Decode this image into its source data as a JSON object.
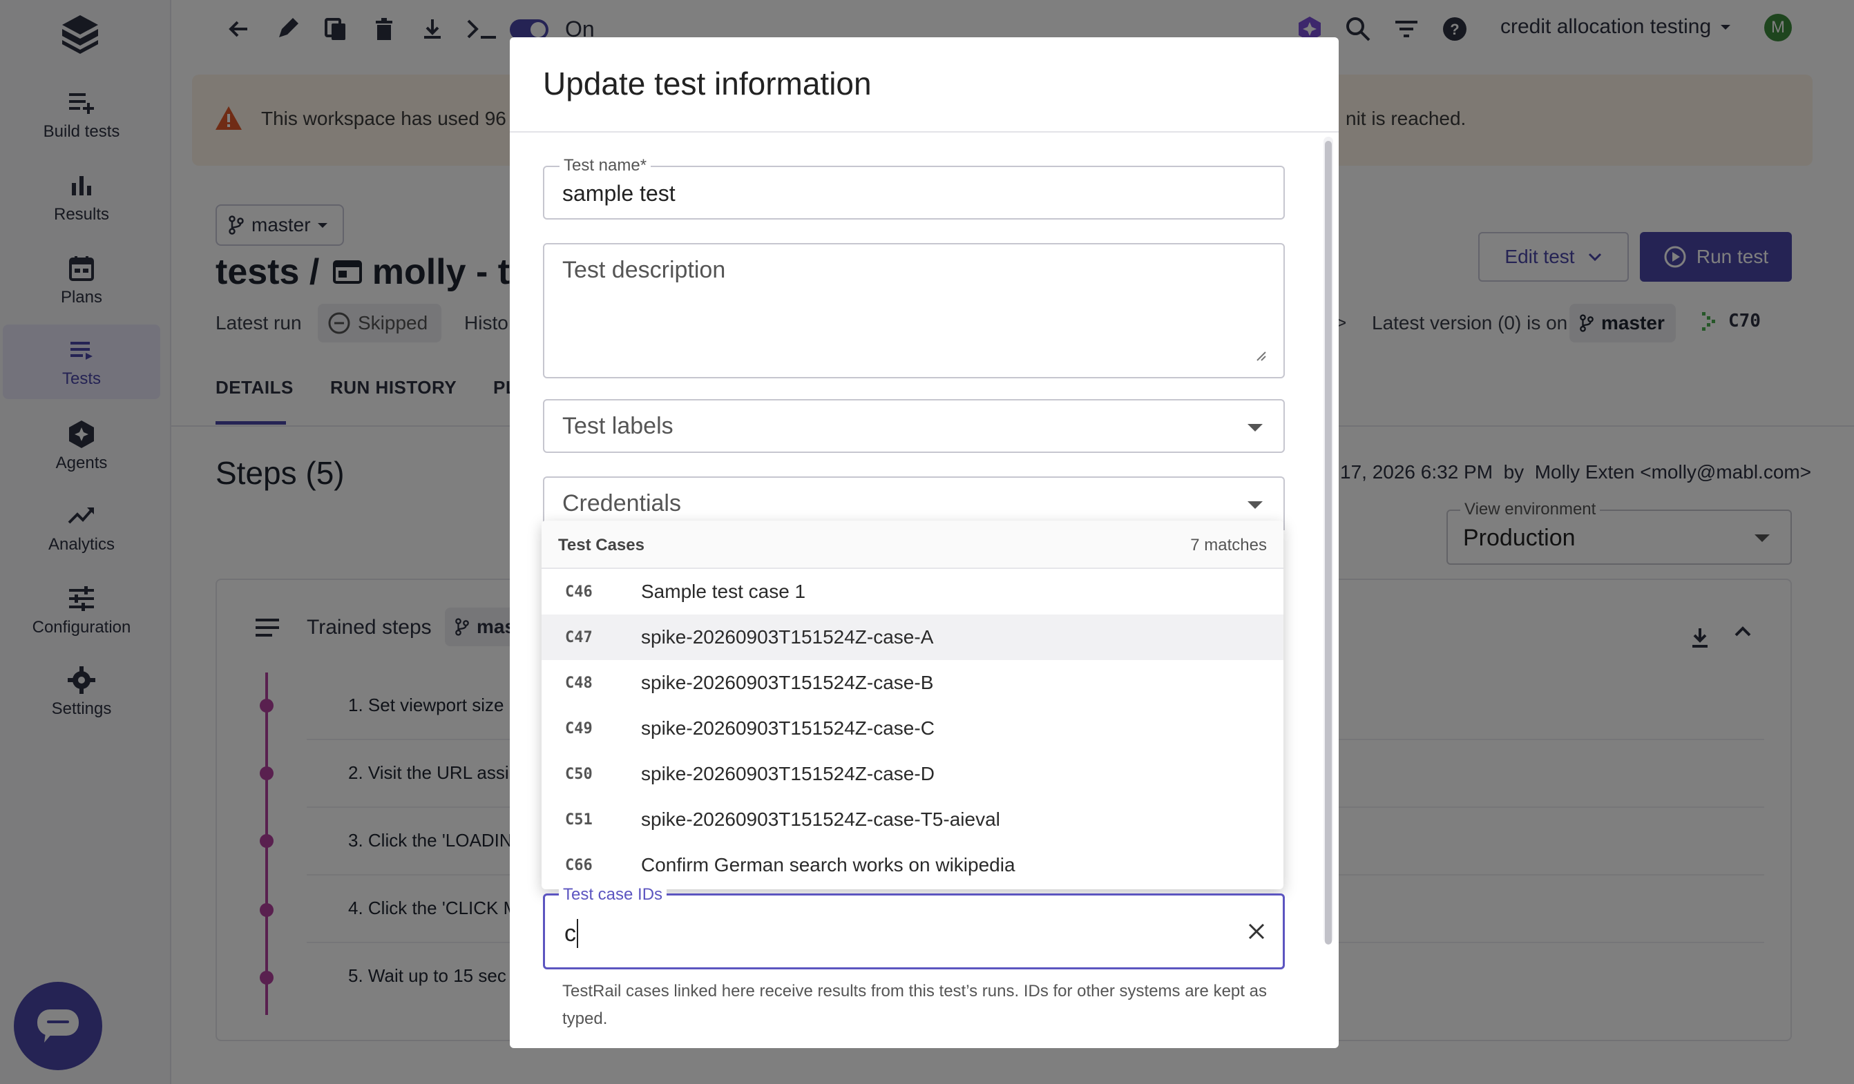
{
  "sidebar": {
    "items": [
      {
        "label": "Build tests",
        "icon": "build-tests-icon"
      },
      {
        "label": "Results",
        "icon": "results-icon"
      },
      {
        "label": "Plans",
        "icon": "plans-icon"
      },
      {
        "label": "Tests",
        "icon": "tests-icon",
        "active": true
      },
      {
        "label": "Agents",
        "icon": "agents-icon"
      },
      {
        "label": "Analytics",
        "icon": "analytics-icon"
      },
      {
        "label": "Configuration",
        "icon": "configuration-icon"
      },
      {
        "label": "Settings",
        "icon": "settings-icon"
      }
    ]
  },
  "toolbar": {
    "toggle_label": "On",
    "workspace_name": "credit allocation testing",
    "avatar_initial": "M"
  },
  "banner": {
    "text_left": "This workspace has used 96",
    "text_right": "nit is reached."
  },
  "header": {
    "branch": "master",
    "breadcrumb": "tests / ",
    "test_title": "molly - te",
    "latest_run_label": "Latest run",
    "latest_run_status": "Skipped",
    "history_label": "Histo",
    "latest_version_text": "Latest version (0) is on",
    "version_branch": "master",
    "case_id": "C70",
    "edit_test": "Edit test",
    "run_test": "Run test"
  },
  "tabs": [
    "DETAILS",
    "RUN HISTORY",
    "PL"
  ],
  "main": {
    "steps_title": "Steps (5)",
    "updated_text": "17, 2026 6:32 PM  by  Molly Exten <molly@mabl.com>",
    "view_env_label": "View environment",
    "view_env_value": "Production",
    "trained_steps": "Trained steps",
    "trained_branch": "mas",
    "steps": [
      "1. Set viewport size",
      "2. Visit the URL assi",
      "3. Click the 'LOADIN",
      "4. Click the 'CLICK M",
      "5. Wait up to 15 sec"
    ]
  },
  "modal": {
    "title": "Update test information",
    "test_name_label": "Test name",
    "test_name_required": "*",
    "test_name_value": "sample test",
    "description_placeholder": "Test description",
    "labels_placeholder": "Test labels",
    "credentials_placeholder": "Credentials",
    "dropdown": {
      "header": "Test Cases",
      "count": "7 matches",
      "options": [
        {
          "id": "C46",
          "name": "Sample test case 1"
        },
        {
          "id": "C47",
          "name": "spike-20260903T151524Z-case-A"
        },
        {
          "id": "C48",
          "name": "spike-20260903T151524Z-case-B"
        },
        {
          "id": "C49",
          "name": "spike-20260903T151524Z-case-C"
        },
        {
          "id": "C50",
          "name": "spike-20260903T151524Z-case-D"
        },
        {
          "id": "C51",
          "name": "spike-20260903T151524Z-case-T5-aieval"
        },
        {
          "id": "C66",
          "name": "Confirm German search works on wikipedia"
        }
      ]
    },
    "test_case_ids_label": "Test case IDs",
    "test_case_ids_value": "c",
    "helper_text": "TestRail cases linked here receive results from this test’s runs. IDs for other systems are kept as typed."
  },
  "colors": {
    "accent": "#4b46a8",
    "active_nav_bg": "#e6e5f7",
    "banner_bg": "#fcf2e6",
    "warning": "#e0592a"
  }
}
